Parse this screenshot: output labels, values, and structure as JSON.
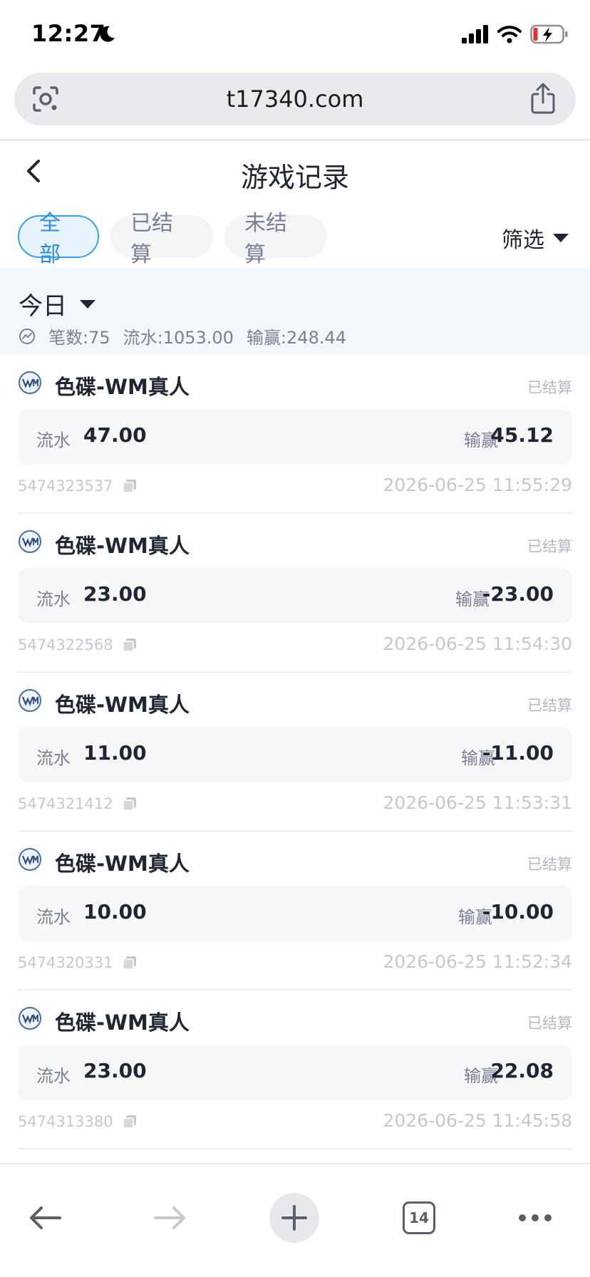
{
  "status_bar": {
    "time": "12:27",
    "icons": [
      "moon-icon",
      "signal-icon",
      "wifi-icon",
      "battery-charging-icon"
    ]
  },
  "browser": {
    "url": "t17340.com",
    "tab_count": "14"
  },
  "header": {
    "title": "游戏记录"
  },
  "tabs": [
    {
      "label": "全部",
      "active": true
    },
    {
      "label": "已结算",
      "active": false
    },
    {
      "label": "未结算",
      "active": false
    }
  ],
  "filter": {
    "label": "筛选"
  },
  "summary": {
    "date_label": "今日",
    "count": "笔数:75",
    "flow": "流水:1053.00",
    "win_loss": "输赢:248.44"
  },
  "labels": {
    "flow": "流水",
    "win_loss": "输赢"
  },
  "records": [
    {
      "game": "色碟-WM真人",
      "status": "已结算",
      "flow": "47.00",
      "win_loss": "45.12",
      "id": "5474323537",
      "time": "2026-06-25 11:55:29"
    },
    {
      "game": "色碟-WM真人",
      "status": "已结算",
      "flow": "23.00",
      "win_loss": "-23.00",
      "id": "5474322568",
      "time": "2026-06-25 11:54:30"
    },
    {
      "game": "色碟-WM真人",
      "status": "已结算",
      "flow": "11.00",
      "win_loss": "-11.00",
      "id": "5474321412",
      "time": "2026-06-25 11:53:31"
    },
    {
      "game": "色碟-WM真人",
      "status": "已结算",
      "flow": "10.00",
      "win_loss": "-10.00",
      "id": "5474320331",
      "time": "2026-06-25 11:52:34"
    },
    {
      "game": "色碟-WM真人",
      "status": "已结算",
      "flow": "23.00",
      "win_loss": "22.08",
      "id": "5474313380",
      "time": "2026-06-25 11:45:58"
    }
  ],
  "colors": {
    "accent": "#2a8be6",
    "summary_bg": "#f2f7fc",
    "muted": "#7a8194"
  }
}
